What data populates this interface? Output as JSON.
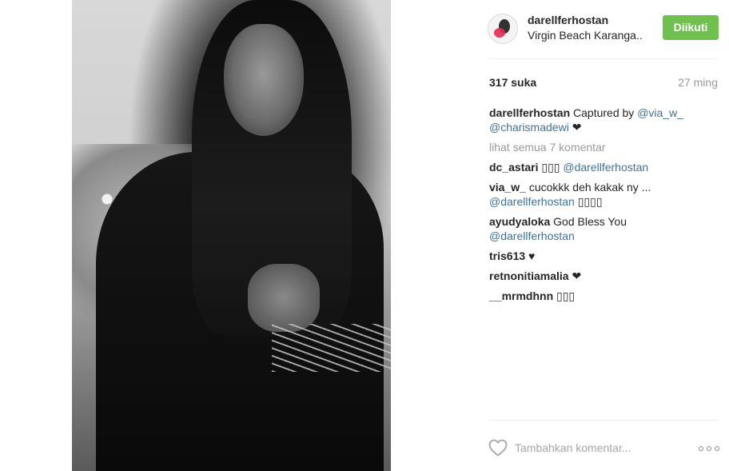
{
  "post": {
    "username": "darellferhostan",
    "location": "Virgin Beach Karanga..",
    "follow_label": "Diikuti",
    "likes": "317 suka",
    "time": "27 ming"
  },
  "caption": {
    "user": "darellferhostan",
    "text": "Captured by",
    "mention1": "@via_w_",
    "mention2": "@charismadewi",
    "tail": "❤"
  },
  "view_all": "lihat semua 7 komentar",
  "comments": [
    {
      "user": "dc_astari",
      "text": "▯▯▯",
      "mention": "@darellferhostan",
      "tail": ""
    },
    {
      "user": "via_w_",
      "text": "cucokkk deh kakak ny ...",
      "mention": "@darellferhostan",
      "tail": "▯▯▯▯"
    },
    {
      "user": "ayudyaloka",
      "text": "God Bless You",
      "mention": "@darellferhostan",
      "tail": ""
    },
    {
      "user": "tris613",
      "text": "♥",
      "mention": "",
      "tail": ""
    },
    {
      "user": "retnonitiamalia",
      "text": "❤",
      "mention": "",
      "tail": ""
    },
    {
      "user": "__mrmdhnn",
      "text": "▯▯▯",
      "mention": "",
      "tail": ""
    }
  ],
  "comment_input": {
    "placeholder": "Tambahkan komentar..."
  },
  "icons": {
    "like": "heart-outline-icon",
    "more": "more-options-icon",
    "avatar": "user-avatar"
  },
  "colors": {
    "follow": "#70c050",
    "mention": "#3f729b",
    "muted": "#999999"
  }
}
